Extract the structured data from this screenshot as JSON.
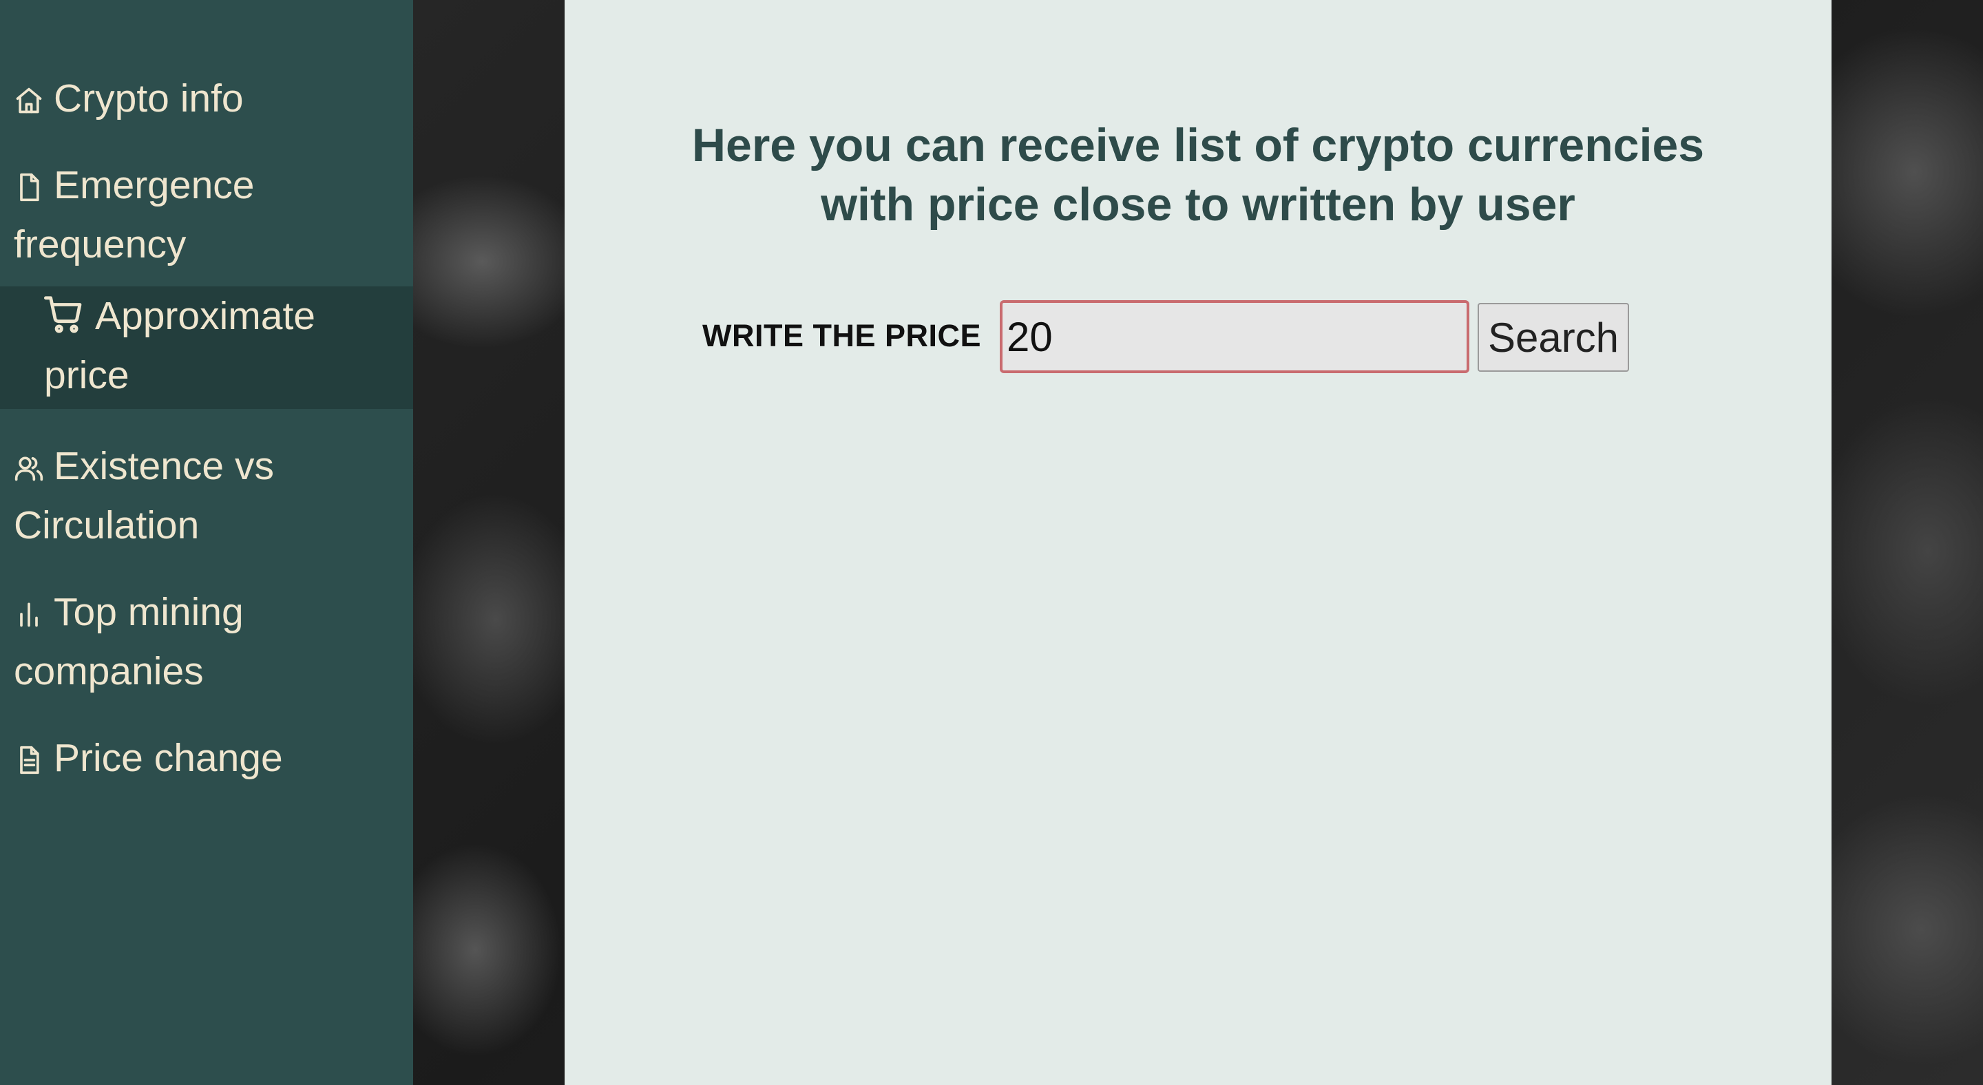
{
  "sidebar": {
    "items": [
      {
        "label": "Crypto info",
        "icon": "home-icon"
      },
      {
        "label": "Emergence frequency",
        "icon": "file-icon"
      },
      {
        "label": "Approximate price",
        "icon": "cart-icon",
        "active": true
      },
      {
        "label": "Existence vs Circulation",
        "icon": "users-icon"
      },
      {
        "label": "Top mining companies",
        "icon": "bar-chart-icon"
      },
      {
        "label": "Price change",
        "icon": "file-text-icon"
      }
    ]
  },
  "main": {
    "heading_line1": "Here you can receive list of crypto currencies",
    "heading_line2": "with price close to written by user",
    "price_label": "WRITE THE PRICE",
    "price_value": "20",
    "search_label": "Search"
  },
  "colors": {
    "sidebar_bg": "#2d4e4d",
    "sidebar_active_bg": "#233e3d",
    "sidebar_text": "#efe6cf",
    "heading_text": "#2e4b4a",
    "panel_bg": "#e3ebe8",
    "input_border": "#c96b6f"
  }
}
